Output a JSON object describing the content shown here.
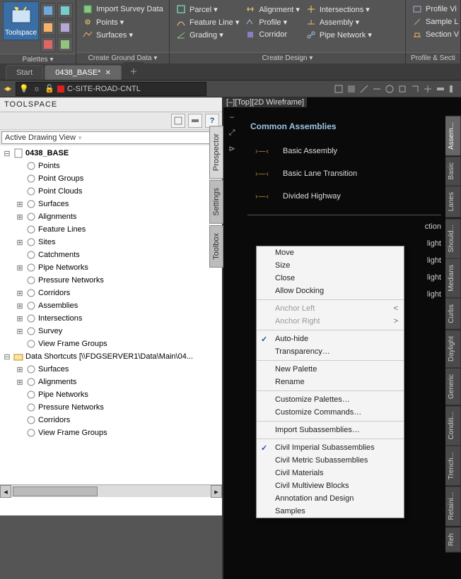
{
  "ribbon": {
    "palettes": {
      "title": "Palettes ▾",
      "big": "Toolspace"
    },
    "ground": {
      "title": "Create Ground Data ▾",
      "rows": [
        "Import Survey Data",
        "Points ▾",
        "Surfaces ▾"
      ]
    },
    "design": {
      "title": "Create Design ▾",
      "col1": [
        "Parcel ▾",
        "Feature Line ▾",
        "Grading ▾"
      ],
      "col2": [
        "Alignment ▾",
        "Profile ▾",
        "Corridor"
      ],
      "col3": [
        "Intersections ▾",
        "Assembly ▾",
        "Pipe Network ▾"
      ]
    },
    "sections": {
      "title": "Profile & Secti",
      "rows": [
        "Profile Vi",
        "Sample L",
        "Section V"
      ]
    }
  },
  "tabs": {
    "start": "Start",
    "file": "0438_BASE*"
  },
  "layer": {
    "name": "C-SITE-ROAD-CNTL"
  },
  "toolspace": {
    "title": "TOOLSPACE",
    "view": "Active Drawing View",
    "sideTabs": [
      "Prospector",
      "Settings",
      "Toolbox"
    ],
    "root": "0438_BASE",
    "rootItems": [
      "Points",
      "Point Groups",
      "Point Clouds",
      "Surfaces",
      "Alignments",
      "Feature Lines",
      "Sites",
      "Catchments",
      "Pipe Networks",
      "Pressure Networks",
      "Corridors",
      "Assemblies",
      "Intersections",
      "Survey",
      "View Frame Groups"
    ],
    "shortcuts": "Data Shortcuts [\\\\FDGSERVER1\\Data\\Main\\04...",
    "shortcutItems": [
      "Surfaces",
      "Alignments",
      "Pipe Networks",
      "Pressure Networks",
      "Corridors",
      "View Frame Groups"
    ]
  },
  "canvas": {
    "viewlabel": "[–][Top][2D Wireframe]",
    "palette_title": "Common Assemblies",
    "items": [
      "Basic Assembly",
      "Basic Lane Transition",
      "Divided Highway"
    ],
    "extra": [
      "ction",
      "light",
      "light",
      "light",
      "light"
    ],
    "rtabs": [
      "Assem...",
      "Basic",
      "Lanes",
      "Should...",
      "Medians",
      "Curbs",
      "Daylight",
      "Generic",
      "Conditi...",
      "Trench...",
      "Retaini...",
      "Reh"
    ]
  },
  "ctx": {
    "move": "Move",
    "size": "Size",
    "close": "Close",
    "dock": "Allow Docking",
    "aleft": "Anchor Left",
    "aright": "Anchor Right",
    "autohide": "Auto-hide",
    "transp": "Transparency…",
    "newp": "New Palette",
    "rename": "Rename",
    "custp": "Customize Palettes…",
    "custc": "Customize Commands…",
    "import": "Import Subassemblies…",
    "cis": "Civil Imperial Subassemblies",
    "cms": "Civil Metric Subassemblies",
    "cmat": "Civil Materials",
    "cmb": "Civil Multiview Blocks",
    "ad": "Annotation and Design",
    "samp": "Samples"
  }
}
